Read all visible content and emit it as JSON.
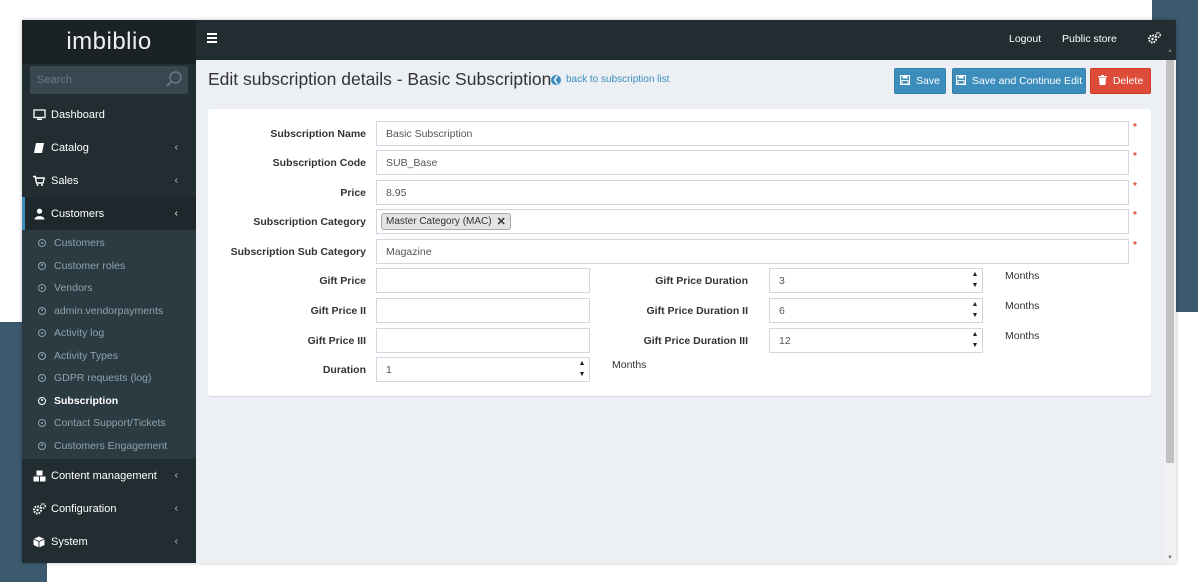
{
  "app": {
    "logo": "imbiblio"
  },
  "sidebar": {
    "search_placeholder": "Search",
    "menu": [
      {
        "label": "Dashboard",
        "icon": "monitor-icon"
      },
      {
        "label": "Catalog",
        "icon": "book-icon"
      },
      {
        "label": "Sales",
        "icon": "cart-icon"
      },
      {
        "label": "Customers",
        "icon": "user-icon"
      }
    ],
    "customers_submenu": [
      "Customers",
      "Customer roles",
      "Vendors",
      "admin.vendorpayments",
      "Activity log",
      "Activity Types",
      "GDPR requests (log)",
      "Subscription",
      "Contact Support/Tickets",
      "Customers Engagement"
    ],
    "menu_after": [
      {
        "label": "Content management",
        "icon": "cubes-icon"
      },
      {
        "label": "Configuration",
        "icon": "gears-icon"
      },
      {
        "label": "System",
        "icon": "cube-icon"
      }
    ]
  },
  "topbar": {
    "logout": "Logout",
    "public_store": "Public store"
  },
  "page": {
    "title": "Edit subscription details - Basic Subscription",
    "back_link": "back to subscription list",
    "buttons": {
      "save": "Save",
      "save_continue": "Save and Continue Edit",
      "delete": "Delete"
    }
  },
  "form": {
    "subscription_name": {
      "label": "Subscription Name",
      "value": "Basic Subscription"
    },
    "subscription_code": {
      "label": "Subscription Code",
      "value": "SUB_Base"
    },
    "price": {
      "label": "Price",
      "value": "8.95"
    },
    "subscription_category": {
      "label": "Subscription Category",
      "tag": "Master Category (MAC)"
    },
    "subscription_sub_category": {
      "label": "Subscription Sub Category",
      "value": "Magazine"
    },
    "gift_price": {
      "label": "Gift Price",
      "value": ""
    },
    "gift_price_ii": {
      "label": "Gift Price II",
      "value": ""
    },
    "gift_price_iii": {
      "label": "Gift Price III",
      "value": ""
    },
    "duration": {
      "label": "Duration",
      "value": "1",
      "unit": "Months"
    },
    "gift_price_duration": {
      "label": "Gift Price Duration",
      "value": "3",
      "unit": "Months"
    },
    "gift_price_duration_ii": {
      "label": "Gift Price Duration II",
      "value": "6",
      "unit": "Months"
    },
    "gift_price_duration_iii": {
      "label": "Gift Price Duration III",
      "value": "12",
      "unit": "Months"
    },
    "required_mark": "*"
  },
  "colors": {
    "primary": "#3c8dbc",
    "danger": "#dd4b39",
    "sidebar": "#222d32"
  }
}
